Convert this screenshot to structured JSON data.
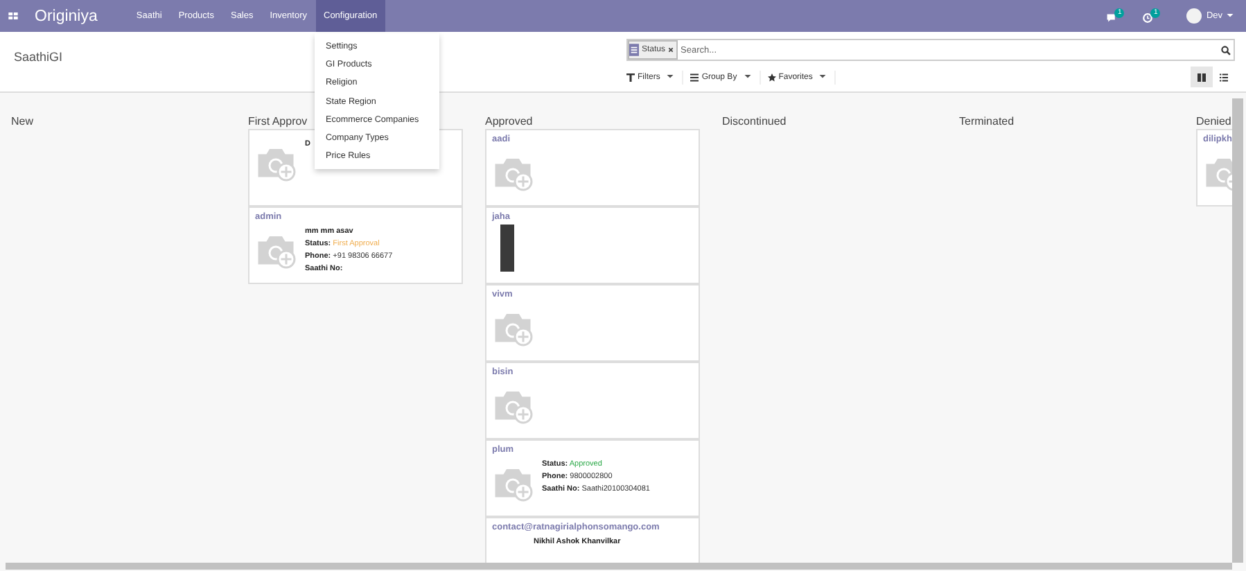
{
  "navbar": {
    "brand": "Originiya",
    "menus": [
      {
        "label": "Saathi",
        "selected": false
      },
      {
        "label": "Products",
        "selected": false
      },
      {
        "label": "Sales",
        "selected": false
      },
      {
        "label": "Inventory",
        "selected": false
      },
      {
        "label": "Configuration",
        "selected": true
      }
    ],
    "message_badge": "1",
    "activity_badge": "1",
    "user": "Dev"
  },
  "dropdown": {
    "items": [
      "Settings",
      "GI Products",
      "Religion",
      "State Region",
      "Ecommerce Companies",
      "Company Types",
      "Price Rules"
    ]
  },
  "breadcrumb": "SaathiGI",
  "search": {
    "facet": "Status",
    "placeholder": "Search..."
  },
  "filters": [
    "Filters",
    "Group By",
    "Favorites"
  ],
  "views": [
    {
      "kind": "kanban",
      "selected": true
    },
    {
      "kind": "list",
      "selected": false
    }
  ],
  "columns": [
    {
      "title": "New"
    },
    {
      "title": "First Approv",
      "cards": [
        {
          "kind": "camera",
          "name": "D"
        },
        {
          "kind": "camera",
          "title": "admin",
          "name": "mm mm asav",
          "lines": [
            {
              "label": "Status:",
              "value": "First Approval",
              "color": "#f0ad4e"
            },
            {
              "label": "Phone:",
              "value": "+91 98306 66677",
              "color": "#333333"
            },
            {
              "label": "Saathi No:"
            }
          ]
        }
      ]
    },
    {
      "title": "Approved",
      "cards": [
        {
          "kind": "camera",
          "title": "aadi"
        },
        {
          "kind": "photo",
          "title": "jaha"
        },
        {
          "kind": "camera",
          "title": "vivm"
        },
        {
          "kind": "camera",
          "title": "bisin"
        },
        {
          "kind": "camera",
          "title": "plum",
          "lines": [
            {
              "label": "Status:",
              "value": "Approved",
              "color": "#28a745"
            },
            {
              "label": "Phone:",
              "value": "9800002800",
              "color": "#333333"
            },
            {
              "label": "Saathi No:",
              "value": "Saathi20100304081",
              "color": "#333333"
            }
          ]
        },
        {
          "kind": "text",
          "title": "contact@ratnagirialphonsomango.com",
          "name": "Nikhil Ashok Khanvilkar"
        }
      ]
    },
    {
      "title": "Discontinued"
    },
    {
      "title": "Terminated"
    },
    {
      "title": "Denied",
      "cards": [
        {
          "kind": "camera",
          "title": "dilipkh"
        }
      ]
    }
  ]
}
